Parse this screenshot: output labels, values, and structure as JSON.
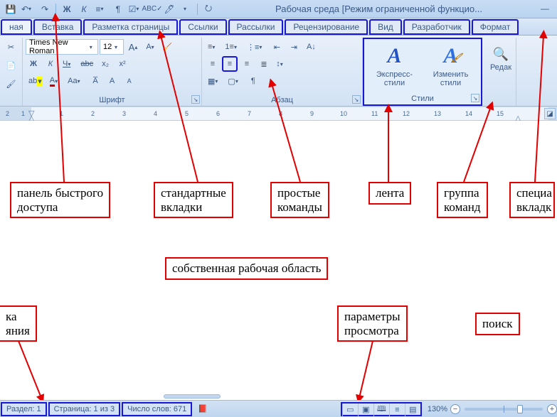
{
  "title": "Рабочая среда [Режим ограниченной функцио...",
  "tabs": [
    "ная",
    "Вставка",
    "Разметка страницы",
    "Ссылки",
    "Рассылки",
    "Рецензирование",
    "Вид",
    "Разработчик",
    "Формат"
  ],
  "font": {
    "name": "Times New Roman",
    "size": "12"
  },
  "groups": {
    "font": "Шрифт",
    "para": "Абзац",
    "styles": "Стили"
  },
  "style_buttons": {
    "quick": "Экспресс-стили",
    "change": "Изменить\nстили",
    "edit": "Редак"
  },
  "ruler_ticks": [
    "2",
    "1",
    "·",
    "1",
    "2",
    "3",
    "4",
    "5",
    "6",
    "7",
    "8",
    "9",
    "10",
    "11",
    "12",
    "13",
    "14",
    "15"
  ],
  "callouts": {
    "qat": "панель быстрого\nдоступа",
    "tabs_std": "стандартные\nвкладки",
    "cmds": "простые\nкоманды",
    "ribbon": "лента",
    "group": "группа\nкоманд",
    "special": "специа\nвкладк",
    "work_area": "собственная рабочая область",
    "state_left": "ка\nяния",
    "view_params": "параметры\nпросмотра",
    "search": "поиск"
  },
  "status": {
    "section": "Раздел: 1",
    "page": "Страница: 1 из 3",
    "words": "Число слов: 671",
    "zoom": "130%"
  }
}
